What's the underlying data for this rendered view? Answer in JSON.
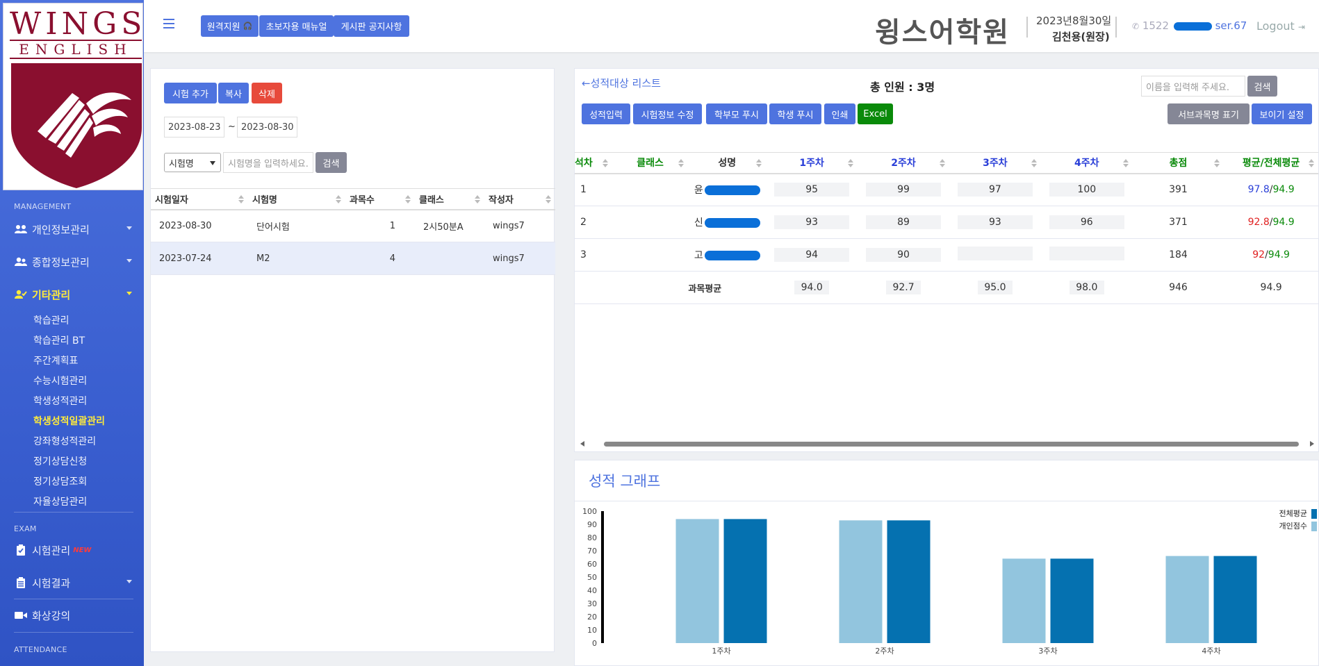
{
  "sidebar": {
    "logo": {
      "title": "WINGS",
      "subtitle": "ENGLISH"
    },
    "sections": [
      {
        "heading": "MANAGEMENT"
      },
      {
        "heading": "EXAM"
      },
      {
        "heading": "ATTENDANCE"
      }
    ],
    "items": [
      {
        "label": "개인정보관리",
        "icon": "users-icon"
      },
      {
        "label": "종합정보관리",
        "icon": "user-group-icon"
      },
      {
        "label": "기타관리",
        "icon": "user-check-icon"
      }
    ],
    "sub_items": [
      "학습관리",
      "학습관리 BT",
      "주간계획표",
      "수능시험관리",
      "학생성적관리",
      "학생성적일괄관리",
      "강좌형성적관리",
      "정기상담신청",
      "정기상담조회",
      "자율상담관리"
    ],
    "exam_items": [
      {
        "label": "시험관리",
        "badge": "NEW",
        "icon": "clipboard-check-icon"
      },
      {
        "label": "시험결과",
        "icon": "clipboard-list-icon"
      },
      {
        "label": "화상강의",
        "icon": "video-icon"
      }
    ]
  },
  "topbar": {
    "buttons": {
      "remote": "원격지원",
      "manual": "초보자용 매뉴얼",
      "notice": "게시판 공지사항"
    },
    "brand": "윙스어학원",
    "date": "2023년8월30일",
    "user": "김천용(원장)",
    "phone_prefix": "1522",
    "phone_suffix": "ser.67",
    "logout": "Logout"
  },
  "left": {
    "buttons": {
      "add": "시험 추가",
      "copy": "복사",
      "delete": "삭제",
      "search": "검색"
    },
    "date_from": "2023-08-23",
    "date_sep": "~",
    "date_to": "2023-08-30",
    "filter_select": "시험명",
    "search_placeholder": "시험명을 입력하세요.",
    "columns": [
      "시험일자",
      "시험명",
      "과목수",
      "클래스",
      "작성자"
    ],
    "rows": [
      {
        "date": "2023-08-30",
        "name": "단어시험",
        "subjects": "1",
        "class": "2시50분A",
        "author": "wings7"
      },
      {
        "date": "2023-07-24",
        "name": "M2",
        "subjects": "4",
        "class": "",
        "author": "wings7"
      }
    ]
  },
  "right": {
    "back_link": "←성적대상 리스트",
    "total": "총 인원 : 3명",
    "name_placeholder": "이름을 입력해 주세요.",
    "buttons": {
      "search": "검색",
      "input": "성적입력",
      "edit": "시험정보 수정",
      "parent_push": "학부모 푸시",
      "student_push": "학생 푸시",
      "print": "인쇄",
      "excel": "Excel",
      "subname": "서브과목명 표기",
      "view": "보이기 설정"
    },
    "columns": [
      "석차",
      "클래스",
      "성명",
      "1주차",
      "2주차",
      "3주차",
      "4주차",
      "총점",
      "평균/전체평균"
    ],
    "rows": [
      {
        "rank": "1",
        "class": "",
        "name": "윤",
        "w1": "95",
        "w2": "99",
        "w3": "97",
        "w4": "100",
        "total": "391",
        "avg": "97.8",
        "all_avg": "94.9",
        "avg_color": "blue"
      },
      {
        "rank": "2",
        "class": "",
        "name": "신",
        "w1": "93",
        "w2": "89",
        "w3": "93",
        "w4": "96",
        "total": "371",
        "avg": "92.8",
        "all_avg": "94.9",
        "avg_color": "red"
      },
      {
        "rank": "3",
        "class": "",
        "name": "고",
        "w1": "94",
        "w2": "90",
        "w3": "",
        "w4": "",
        "total": "184",
        "avg": "92",
        "all_avg": "94.9",
        "avg_color": "red"
      }
    ],
    "summary": {
      "label": "과목평균",
      "w1": "94.0",
      "w2": "92.7",
      "w3": "95.0",
      "w4": "98.0",
      "total": "946",
      "avg": "94.9"
    },
    "avg_sep": "/"
  },
  "chart_data": {
    "type": "bar",
    "title": "성적 그래프",
    "categories": [
      "1주차",
      "2주차",
      "3주차",
      "4주차"
    ],
    "series": [
      {
        "name": "개인점수",
        "values": [
          94,
          93,
          64,
          66
        ],
        "color": "#92c5de"
      },
      {
        "name": "전체평균",
        "values": [
          94,
          93,
          64,
          66
        ],
        "color": "#0571b0"
      }
    ],
    "ylim": [
      0,
      100
    ],
    "yticks": [
      0,
      10,
      20,
      30,
      40,
      50,
      60,
      70,
      80,
      90,
      100
    ],
    "legend": "top-right",
    "legend_order": [
      "전체평균",
      "개인점수"
    ]
  }
}
